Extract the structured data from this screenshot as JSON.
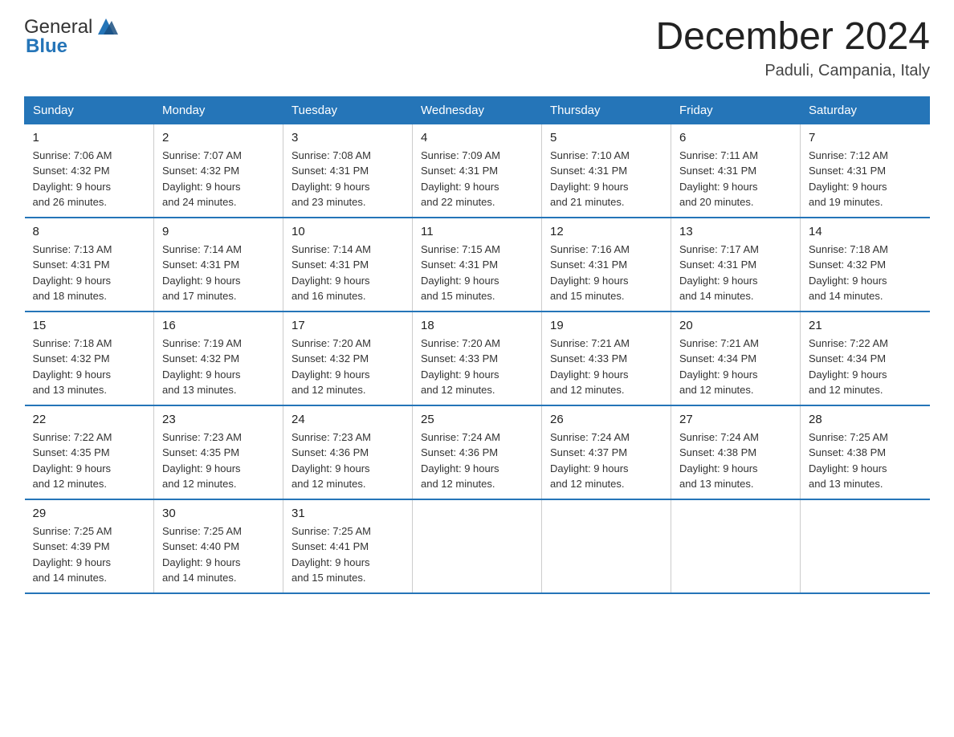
{
  "logo": {
    "text_general": "General",
    "text_blue": "Blue"
  },
  "header": {
    "month": "December 2024",
    "location": "Paduli, Campania, Italy"
  },
  "days_of_week": [
    "Sunday",
    "Monday",
    "Tuesday",
    "Wednesday",
    "Thursday",
    "Friday",
    "Saturday"
  ],
  "weeks": [
    [
      {
        "day": "1",
        "sunrise": "7:06 AM",
        "sunset": "4:32 PM",
        "daylight": "9 hours and 26 minutes."
      },
      {
        "day": "2",
        "sunrise": "7:07 AM",
        "sunset": "4:32 PM",
        "daylight": "9 hours and 24 minutes."
      },
      {
        "day": "3",
        "sunrise": "7:08 AM",
        "sunset": "4:31 PM",
        "daylight": "9 hours and 23 minutes."
      },
      {
        "day": "4",
        "sunrise": "7:09 AM",
        "sunset": "4:31 PM",
        "daylight": "9 hours and 22 minutes."
      },
      {
        "day": "5",
        "sunrise": "7:10 AM",
        "sunset": "4:31 PM",
        "daylight": "9 hours and 21 minutes."
      },
      {
        "day": "6",
        "sunrise": "7:11 AM",
        "sunset": "4:31 PM",
        "daylight": "9 hours and 20 minutes."
      },
      {
        "day": "7",
        "sunrise": "7:12 AM",
        "sunset": "4:31 PM",
        "daylight": "9 hours and 19 minutes."
      }
    ],
    [
      {
        "day": "8",
        "sunrise": "7:13 AM",
        "sunset": "4:31 PM",
        "daylight": "9 hours and 18 minutes."
      },
      {
        "day": "9",
        "sunrise": "7:14 AM",
        "sunset": "4:31 PM",
        "daylight": "9 hours and 17 minutes."
      },
      {
        "day": "10",
        "sunrise": "7:14 AM",
        "sunset": "4:31 PM",
        "daylight": "9 hours and 16 minutes."
      },
      {
        "day": "11",
        "sunrise": "7:15 AM",
        "sunset": "4:31 PM",
        "daylight": "9 hours and 15 minutes."
      },
      {
        "day": "12",
        "sunrise": "7:16 AM",
        "sunset": "4:31 PM",
        "daylight": "9 hours and 15 minutes."
      },
      {
        "day": "13",
        "sunrise": "7:17 AM",
        "sunset": "4:31 PM",
        "daylight": "9 hours and 14 minutes."
      },
      {
        "day": "14",
        "sunrise": "7:18 AM",
        "sunset": "4:32 PM",
        "daylight": "9 hours and 14 minutes."
      }
    ],
    [
      {
        "day": "15",
        "sunrise": "7:18 AM",
        "sunset": "4:32 PM",
        "daylight": "9 hours and 13 minutes."
      },
      {
        "day": "16",
        "sunrise": "7:19 AM",
        "sunset": "4:32 PM",
        "daylight": "9 hours and 13 minutes."
      },
      {
        "day": "17",
        "sunrise": "7:20 AM",
        "sunset": "4:32 PM",
        "daylight": "9 hours and 12 minutes."
      },
      {
        "day": "18",
        "sunrise": "7:20 AM",
        "sunset": "4:33 PM",
        "daylight": "9 hours and 12 minutes."
      },
      {
        "day": "19",
        "sunrise": "7:21 AM",
        "sunset": "4:33 PM",
        "daylight": "9 hours and 12 minutes."
      },
      {
        "day": "20",
        "sunrise": "7:21 AM",
        "sunset": "4:34 PM",
        "daylight": "9 hours and 12 minutes."
      },
      {
        "day": "21",
        "sunrise": "7:22 AM",
        "sunset": "4:34 PM",
        "daylight": "9 hours and 12 minutes."
      }
    ],
    [
      {
        "day": "22",
        "sunrise": "7:22 AM",
        "sunset": "4:35 PM",
        "daylight": "9 hours and 12 minutes."
      },
      {
        "day": "23",
        "sunrise": "7:23 AM",
        "sunset": "4:35 PM",
        "daylight": "9 hours and 12 minutes."
      },
      {
        "day": "24",
        "sunrise": "7:23 AM",
        "sunset": "4:36 PM",
        "daylight": "9 hours and 12 minutes."
      },
      {
        "day": "25",
        "sunrise": "7:24 AM",
        "sunset": "4:36 PM",
        "daylight": "9 hours and 12 minutes."
      },
      {
        "day": "26",
        "sunrise": "7:24 AM",
        "sunset": "4:37 PM",
        "daylight": "9 hours and 12 minutes."
      },
      {
        "day": "27",
        "sunrise": "7:24 AM",
        "sunset": "4:38 PM",
        "daylight": "9 hours and 13 minutes."
      },
      {
        "day": "28",
        "sunrise": "7:25 AM",
        "sunset": "4:38 PM",
        "daylight": "9 hours and 13 minutes."
      }
    ],
    [
      {
        "day": "29",
        "sunrise": "7:25 AM",
        "sunset": "4:39 PM",
        "daylight": "9 hours and 14 minutes."
      },
      {
        "day": "30",
        "sunrise": "7:25 AM",
        "sunset": "4:40 PM",
        "daylight": "9 hours and 14 minutes."
      },
      {
        "day": "31",
        "sunrise": "7:25 AM",
        "sunset": "4:41 PM",
        "daylight": "9 hours and 15 minutes."
      },
      null,
      null,
      null,
      null
    ]
  ],
  "labels": {
    "sunrise": "Sunrise:",
    "sunset": "Sunset:",
    "daylight": "Daylight:"
  }
}
